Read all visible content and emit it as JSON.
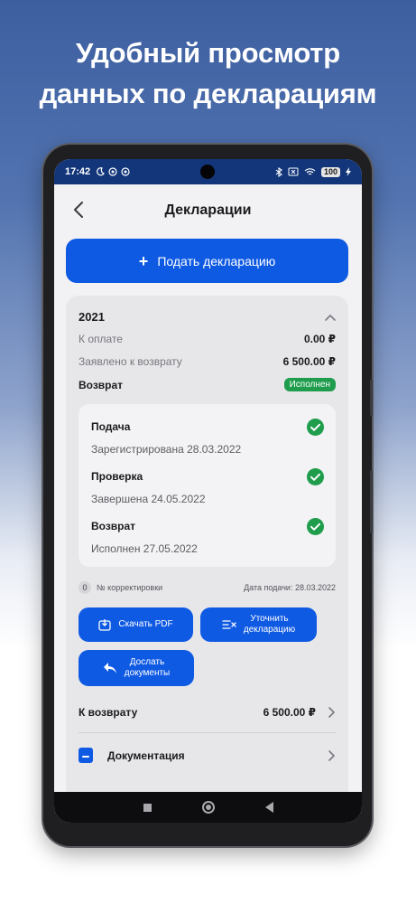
{
  "headline": {
    "line1": "Удобный просмотр",
    "line2": "данных по декларациям"
  },
  "status_bar": {
    "time": "17:42",
    "battery": "100"
  },
  "app_bar": {
    "title": "Декларации"
  },
  "primary_action": {
    "label": "Подать декларацию"
  },
  "declaration": {
    "year": "2021",
    "to_pay_label": "К оплате",
    "to_pay_value": "0.00 ₽",
    "claimed_label": "Заявлено к возврату",
    "claimed_value": "6 500.00 ₽",
    "refund_label": "Возврат",
    "refund_status": "Исполнен",
    "steps": [
      {
        "title": "Подача",
        "subtitle": "Зарегистрирована 28.03.2022"
      },
      {
        "title": "Проверка",
        "subtitle": "Завершена 24.05.2022"
      },
      {
        "title": "Возврат",
        "subtitle": "Исполнен 27.05.2022"
      }
    ],
    "correction_number": "0",
    "correction_label": "№ корректировки",
    "submission_date": "Дата подачи: 28.03.2022",
    "buttons": {
      "download_pdf": "Скачать PDF",
      "clarify_line1": "Уточнить",
      "clarify_line2": "декларацию",
      "send_docs_line1": "Дослать",
      "send_docs_line2": "документы"
    },
    "refund_total_label": "К возврату",
    "refund_total_value": "6 500.00 ₽",
    "documentation_label": "Документация"
  },
  "colors": {
    "accent": "#0f5ae3",
    "success": "#1f9d4c",
    "status_bar": "#13367a"
  }
}
